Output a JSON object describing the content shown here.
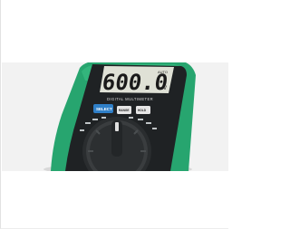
{
  "photo": {
    "subject": "digital multimeter",
    "lcd_reading": "600.0",
    "lcd_unit": "V",
    "lcd_mode_label": "AUTO",
    "body_label": "DIGITAL MULTIMETER",
    "select_button_label": "SELECT",
    "range_button_label": "RANGE",
    "hold_button_label": "HOLD",
    "colors": {
      "background": "#f2f2f2",
      "body_green": "#27a56f",
      "face_black": "#1f2224",
      "lcd": "#dfe1d6",
      "select_blue": "#2f7fc7"
    }
  }
}
